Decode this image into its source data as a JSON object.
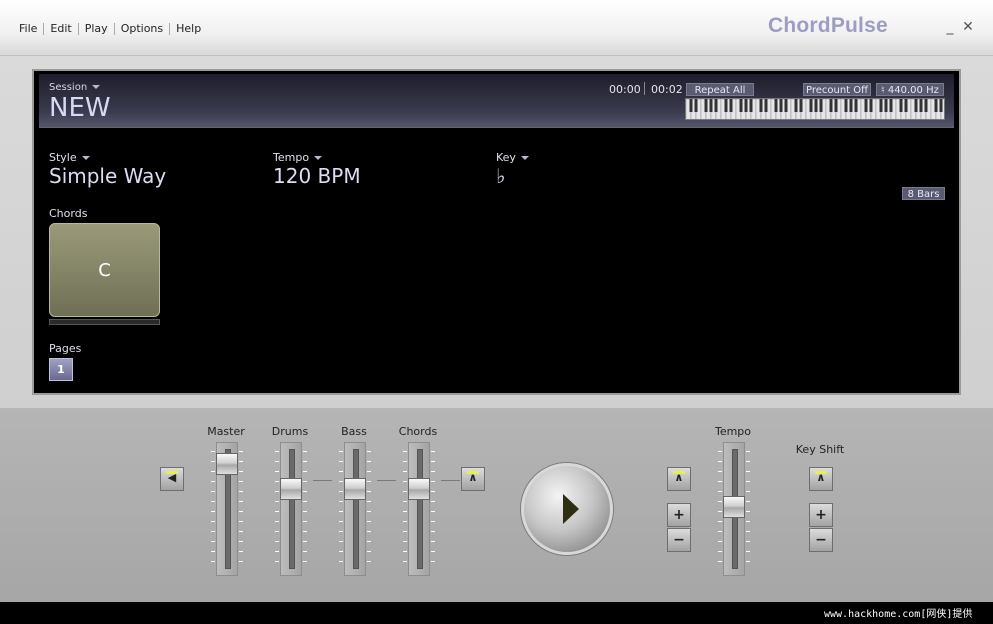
{
  "menu": [
    {
      "label": "File"
    },
    {
      "label": "Edit"
    },
    {
      "label": "Play"
    },
    {
      "label": "Options"
    },
    {
      "label": "Help"
    }
  ],
  "app_title": "ChordPulse",
  "window": {
    "minimize": "_",
    "close": "✕"
  },
  "header": {
    "session_label": "Session",
    "session_name": "NEW",
    "time_elapsed": "00:00",
    "time_total": "00:02",
    "repeat": "Repeat All",
    "precount": "Precount Off",
    "tuning": "♮ 440.00 Hz"
  },
  "style": {
    "label": "Style",
    "value": "Simple Way"
  },
  "tempo": {
    "label": "Tempo",
    "value": "120 BPM"
  },
  "key": {
    "label": "Key",
    "value": "♭"
  },
  "bars_badge": "8 Bars",
  "chords": {
    "label": "Chords",
    "current": "C"
  },
  "pages": {
    "label": "Pages",
    "current": "1"
  },
  "mixer": {
    "master": {
      "label": "Master",
      "level": 0.95
    },
    "drums": {
      "label": "Drums",
      "level": 0.72
    },
    "bass": {
      "label": "Bass",
      "level": 0.72
    },
    "chords": {
      "label": "Chords",
      "level": 0.72
    }
  },
  "tempo_slider": {
    "label": "Tempo",
    "level": 0.55
  },
  "key_shift": {
    "label": "Key Shift"
  },
  "buttons": {
    "plus": "+",
    "minus": "−",
    "reset": "⊼",
    "mute": "◀"
  },
  "watermark": "www.hackhome.com[网侠]提供",
  "colors": {
    "accent": "#9d9dc3",
    "led": "#e8f050"
  }
}
